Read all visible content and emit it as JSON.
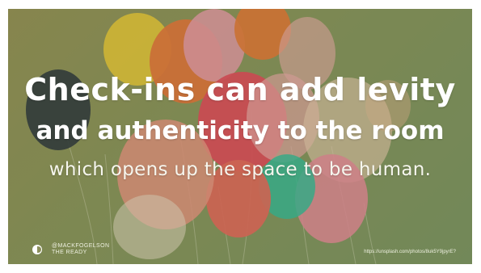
{
  "slide": {
    "title_line1": "Check-ins can add levity",
    "title_line2": "and authenticity to the room",
    "subtitle": "which opens up the space to be human.",
    "footer": {
      "author_line1": "@MACKFOGELSON",
      "author_line2": "THE READY",
      "url": "https://unsplash.com/photos/8uk5Y9jpyrE?"
    }
  },
  "colors": {
    "background": "#8c9a5f",
    "text": "#ffffff"
  }
}
